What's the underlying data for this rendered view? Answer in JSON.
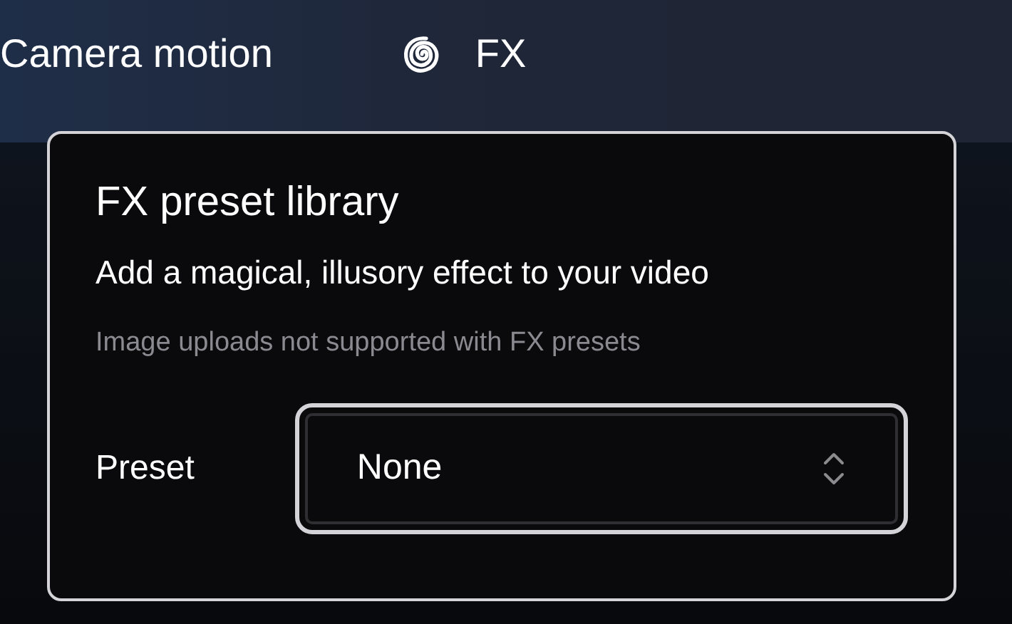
{
  "toolbar": {
    "tabs": [
      {
        "label": "Camera motion",
        "kind": "plain"
      },
      {
        "label": "FX",
        "kind": "spiral"
      }
    ]
  },
  "popover": {
    "title": "FX preset library",
    "description": "Add a magical, illusory effect to your video",
    "note": "Image uploads not supported with FX presets",
    "preset": {
      "label": "Preset",
      "value": "None",
      "focused": true
    }
  }
}
